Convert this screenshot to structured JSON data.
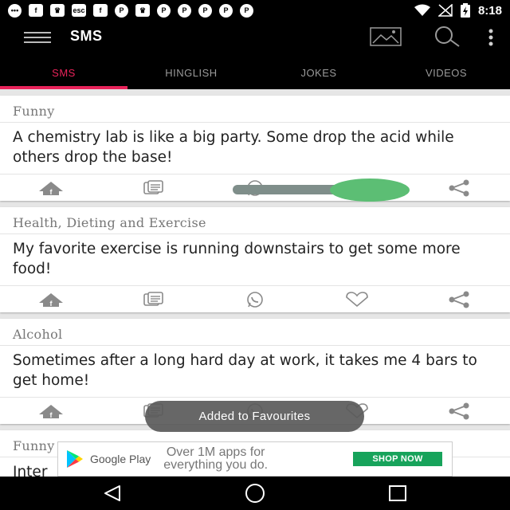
{
  "status_bar": {
    "time": "8:18",
    "notification_icons": [
      {
        "name": "chat-notification-icon",
        "text": "•••"
      },
      {
        "name": "facebook-notification-icon",
        "text": "f"
      },
      {
        "name": "mask-app-notification-icon",
        "text": "♛"
      },
      {
        "name": "esc-notification-icon",
        "text": "esc"
      },
      {
        "name": "facebook-notification-icon-2",
        "text": "f"
      },
      {
        "name": "pinterest-notification-icon",
        "text": "P"
      },
      {
        "name": "mask-app-notification-icon-2",
        "text": "♛"
      },
      {
        "name": "pinterest-notification-icon-2",
        "text": "P"
      },
      {
        "name": "pinterest-notification-icon-3",
        "text": "P"
      },
      {
        "name": "pinterest-notification-icon-4",
        "text": "P"
      },
      {
        "name": "pinterest-notification-icon-5",
        "text": "P"
      },
      {
        "name": "pinterest-notification-icon-6",
        "text": "P"
      }
    ]
  },
  "app_bar": {
    "title": "SMS"
  },
  "tabs": [
    {
      "label": "SMS",
      "active": true
    },
    {
      "label": "HINGLISH",
      "active": false
    },
    {
      "label": "JOKES",
      "active": false
    },
    {
      "label": "VIDEOS",
      "active": false
    }
  ],
  "cards": [
    {
      "category": "Funny",
      "text": "A chemistry lab is like a big party. Some drop the acid while others drop the base!",
      "liked": true
    },
    {
      "category": "Health, Dieting and Exercise",
      "text": "My favorite exercise is running downstairs to get some more food!",
      "liked": false
    },
    {
      "category": "Alcohol",
      "text": "Sometimes after a long hard day at work, it takes me 4 bars to get home!",
      "liked": false
    },
    {
      "category": "Funny",
      "text": "Inter",
      "liked": false
    }
  ],
  "toast": "Added to Favourites",
  "ad": {
    "brand": "Google Play",
    "line1": "Over 1M apps for",
    "line2": "everything you do.",
    "button": "SHOP NOW"
  },
  "colors": {
    "accent": "#e8235a",
    "icon_gray": "#8a8a8a",
    "heart_liked": "#e8235a",
    "shop_button": "#17a35b"
  }
}
